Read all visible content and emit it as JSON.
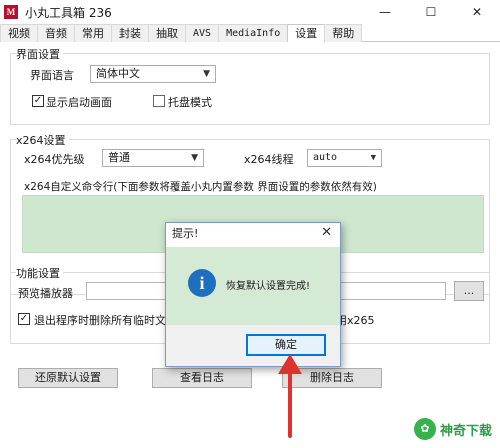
{
  "window": {
    "icon_glyph": "M",
    "title": "小丸工具箱 236",
    "controls": {
      "minimize": "—",
      "maximize": "☐",
      "close": "✕"
    }
  },
  "tabs": [
    {
      "label": "视频"
    },
    {
      "label": "音频"
    },
    {
      "label": "常用"
    },
    {
      "label": "封装"
    },
    {
      "label": "抽取"
    },
    {
      "label": "AVS"
    },
    {
      "label": "MediaInfo"
    },
    {
      "label": "设置",
      "active": true
    },
    {
      "label": "帮助"
    }
  ],
  "interface_settings": {
    "group_title": "界面设置",
    "language_label": "界面语言",
    "language_value": "简体中文",
    "show_splash_label": "显示启动画面",
    "show_splash_checked": true,
    "tray_mode_label": "托盘模式",
    "tray_mode_checked": false
  },
  "x264_settings": {
    "group_title": "x264设置",
    "priority_label": "x264优先级",
    "priority_value": "普通",
    "threads_label": "x264线程",
    "threads_value": "auto",
    "custom_cmd_label": "x264自定义命令行(下面参数将覆盖小丸内置参数 界面设置的参数依然有效)",
    "custom_cmd_value": ""
  },
  "function_settings": {
    "group_title": "功能设置",
    "preview_player_label": "预览播放器",
    "preview_player_value": "",
    "browse_label": "...",
    "delete_temp_label": "退出程序时删除所有临时文件",
    "delete_temp_checked": true,
    "x265_partial": "用x265"
  },
  "buttons": {
    "restore_defaults": "还原默认设置",
    "view_log": "查看日志",
    "delete_log": "删除日志"
  },
  "dialog": {
    "title": "提示!",
    "close": "✕",
    "icon_glyph": "i",
    "message": "恢复默认设置完成!",
    "ok_label": "确定"
  },
  "annotation": {
    "arrow_color": "#e03131"
  },
  "watermark": {
    "logo_glyph": "✿",
    "text": "神奇下载"
  },
  "colors": {
    "accent": "#0078d7",
    "dialog_body": "#d5ead5",
    "cmd_area": "#cfe6cf"
  }
}
